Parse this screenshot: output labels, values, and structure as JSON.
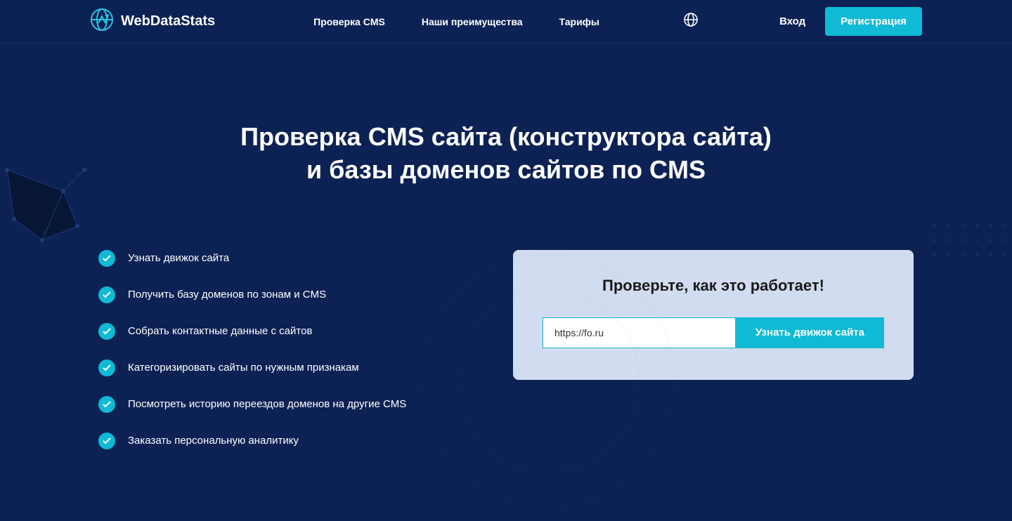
{
  "brand": {
    "name": "WebDataStats"
  },
  "nav": {
    "items": [
      {
        "label": "Проверка CMS"
      },
      {
        "label": "Наши преимущества"
      },
      {
        "label": "Тарифы"
      }
    ]
  },
  "auth": {
    "login": "Вход",
    "register": "Регистрация"
  },
  "hero": {
    "title_line1": "Проверка CMS сайта (конструктора сайта)",
    "title_line2": "и базы доменов сайтов по CMS"
  },
  "features": [
    {
      "text": "Узнать движок сайта"
    },
    {
      "text": "Получить базу доменов по зонам и CMS"
    },
    {
      "text": "Собрать контактные данные с сайтов"
    },
    {
      "text": "Категоризировать сайты по нужным признакам"
    },
    {
      "text": "Посмотреть историю переездов доменов на другие CMS"
    },
    {
      "text": "Заказать персональную аналитику"
    }
  ],
  "try": {
    "title": "Проверьте, как это работает!",
    "input_value": "https://fo.ru",
    "button": "Узнать движок сайта"
  }
}
